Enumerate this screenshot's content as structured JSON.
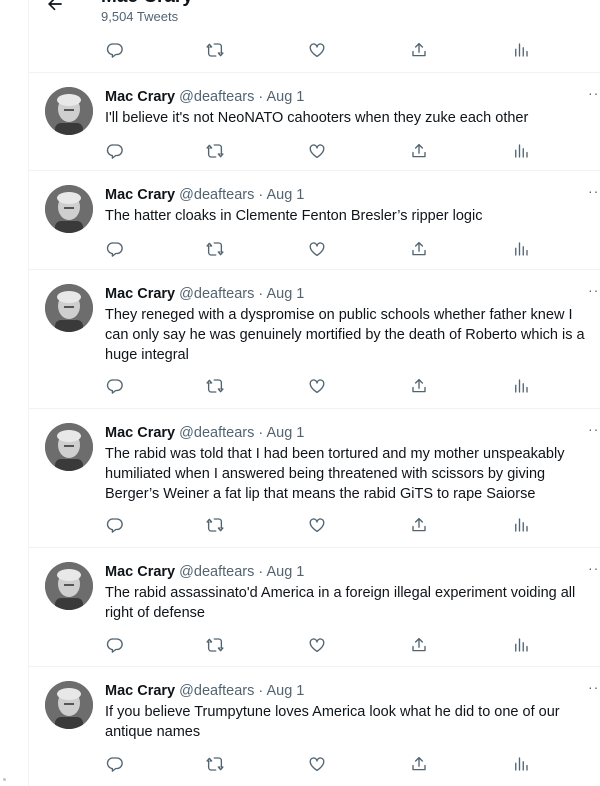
{
  "header": {
    "profile_name": "Mac Crary",
    "tweet_count": "9,504 Tweets"
  },
  "tweets": [
    {
      "display_name": "Mac Crary",
      "handle": "@deaftears",
      "separator": "·",
      "date": "Aug 1",
      "text": "I'll believe it's not NeoNATO cahooters when they zuke each other"
    },
    {
      "display_name": "Mac Crary",
      "handle": "@deaftears",
      "separator": "·",
      "date": "Aug 1",
      "text": "The hatter cloaks in Clemente Fenton Bresler’s ripper logic"
    },
    {
      "display_name": "Mac Crary",
      "handle": "@deaftears",
      "separator": "·",
      "date": "Aug 1",
      "text": "They reneged with a dyspromise on public schools whether father knew I\ncan only say he was genuinely mortified by the death of Roberto which is a\nhuge integral"
    },
    {
      "display_name": "Mac Crary",
      "handle": "@deaftears",
      "separator": "·",
      "date": "Aug 1",
      "text": "The rabid was told that I had been tortured and my mother unspeakably\nhumiliated when I answered being threatened with scissors by giving\nBerger’s Weiner a fat lip that means the rabid GiTS to rape Saiorse"
    },
    {
      "display_name": "Mac Crary",
      "handle": "@deaftears",
      "separator": "·",
      "date": "Aug 1",
      "text": "The rabid assassinato'd America in a foreign illegal experiment voiding all\nright of defense"
    },
    {
      "display_name": "Mac Crary",
      "handle": "@deaftears",
      "separator": "·",
      "date": "Aug 1",
      "text": "If you believe Trumpytune loves America look what he did to one of our\nantique names"
    }
  ],
  "icons": {
    "reply": "reply-icon",
    "retweet": "retweet-icon",
    "like": "like-icon",
    "share": "share-icon",
    "analytics": "analytics-icon",
    "more": "more-icon",
    "back": "back-arrow-icon"
  },
  "colors": {
    "text": "#0f1419",
    "secondary": "#536471",
    "divider": "#eff3f4"
  }
}
